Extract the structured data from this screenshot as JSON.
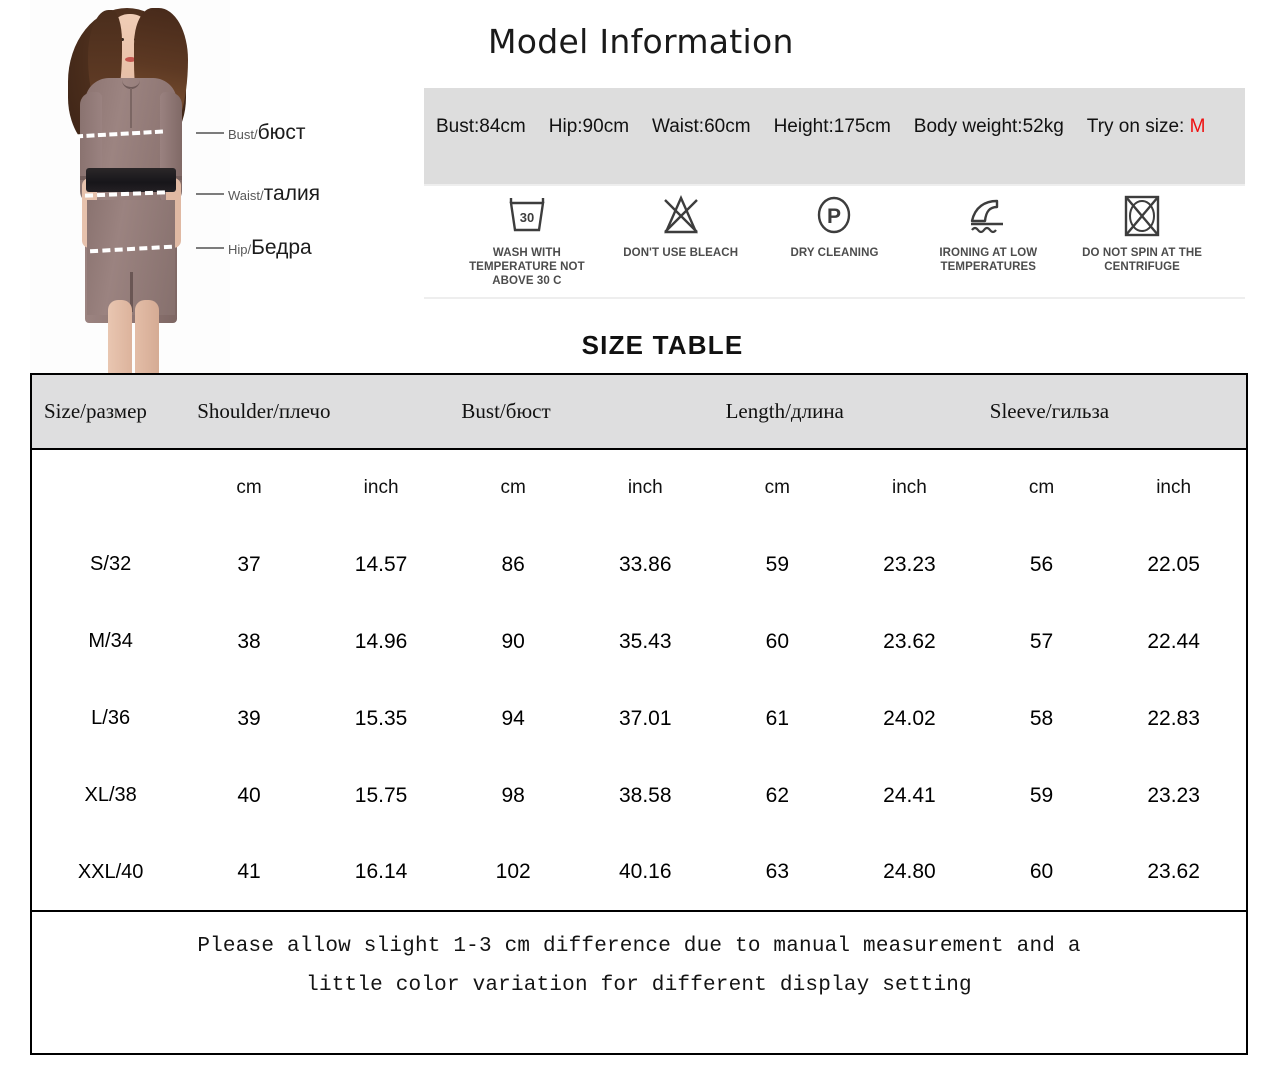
{
  "header": {
    "title": "Model Information"
  },
  "model_diagram": {
    "labels": [
      {
        "en": "Bust/",
        "ru": "бюст",
        "name": "bust"
      },
      {
        "en": "Waist/",
        "ru": "талия",
        "name": "waist"
      },
      {
        "en": "Hip/",
        "ru": "Бедра",
        "name": "hip"
      }
    ]
  },
  "measurements": {
    "accent_color": "#ee1111",
    "band_color": "#dddddd",
    "items": [
      "Bust:84cm",
      "Hip:90cm",
      "Waist:60cm",
      "Height:175cm",
      "Body weight:52kg"
    ],
    "try_on_label": "Try on size: ",
    "try_on_value": "M"
  },
  "care": {
    "items": [
      {
        "icon": "wash-tub-30-icon",
        "text": "WASH WITH TEMPERATURE NOT ABOVE 30 C"
      },
      {
        "icon": "no-bleach-triangle-icon",
        "text": "DON'T USE BLEACH"
      },
      {
        "icon": "dry-clean-p-circle-icon",
        "text": "DRY CLEANING"
      },
      {
        "icon": "iron-low-temp-icon",
        "text": "IRONING AT LOW TEMPERATURES"
      },
      {
        "icon": "no-tumble-spin-icon",
        "text": "DO NOT SPIN AT THE CENTRIFUGE"
      }
    ]
  },
  "size_table": {
    "title": "SIZE TABLE",
    "group_headers": [
      "Size/размер",
      "Shoulder/плечо",
      "Bust/бюст",
      "Length/длина",
      "Sleeve/гильза"
    ],
    "unit_row": [
      "",
      "cm",
      "inch",
      "cm",
      "inch",
      "cm",
      "inch",
      "cm",
      "inch"
    ],
    "rows": [
      {
        "size": "S/32",
        "shoulder_cm": "37",
        "shoulder_in": "14.57",
        "bust_cm": "86",
        "bust_in": "33.86",
        "length_cm": "59",
        "length_in": "23.23",
        "sleeve_cm": "56",
        "sleeve_in": "22.05"
      },
      {
        "size": "M/34",
        "shoulder_cm": "38",
        "shoulder_in": "14.96",
        "bust_cm": "90",
        "bust_in": "35.43",
        "length_cm": "60",
        "length_in": "23.62",
        "sleeve_cm": "57",
        "sleeve_in": "22.44"
      },
      {
        "size": "L/36",
        "shoulder_cm": "39",
        "shoulder_in": "15.35",
        "bust_cm": "94",
        "bust_in": "37.01",
        "length_cm": "61",
        "length_in": "24.02",
        "sleeve_cm": "58",
        "sleeve_in": "22.83"
      },
      {
        "size": "XL/38",
        "shoulder_cm": "40",
        "shoulder_in": "15.75",
        "bust_cm": "98",
        "bust_in": "38.58",
        "length_cm": "62",
        "length_in": "24.41",
        "sleeve_cm": "59",
        "sleeve_in": "23.23"
      },
      {
        "size": "XXL/40",
        "shoulder_cm": "41",
        "shoulder_in": "16.14",
        "bust_cm": "102",
        "bust_in": "40.16",
        "length_cm": "63",
        "length_in": "24.80",
        "sleeve_cm": "60",
        "sleeve_in": "23.62"
      }
    ],
    "note_line_1": "Please allow slight 1-3 cm difference due to manual measurement and a",
    "note_line_2": "little color variation for different display setting"
  }
}
